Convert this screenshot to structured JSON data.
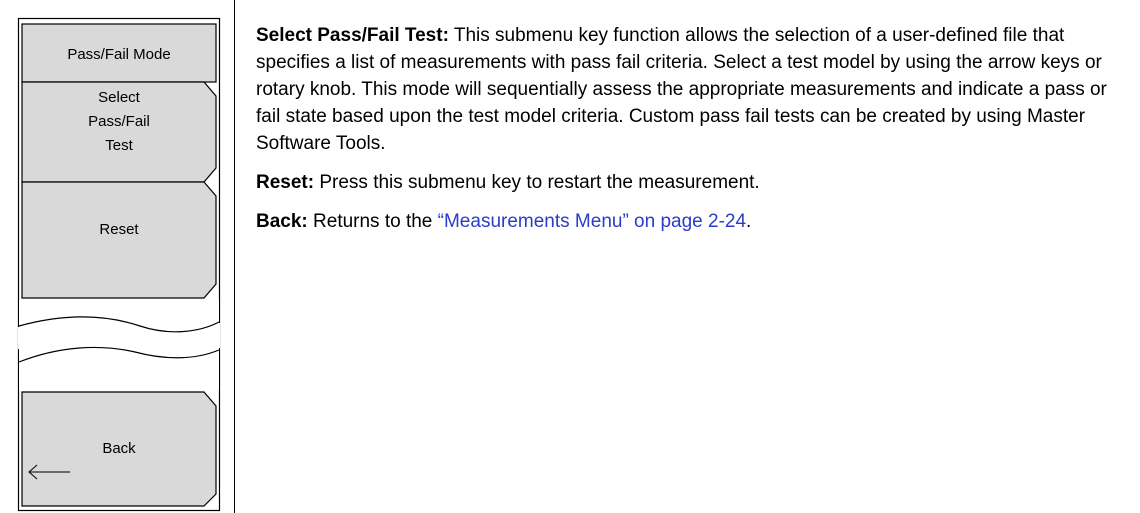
{
  "menu": {
    "title": "Pass/Fail Mode",
    "keys": [
      {
        "label": "Select\nPass/Fail\nTest"
      },
      {
        "label": "Reset"
      }
    ],
    "back": {
      "label": "Back",
      "icon": "left-arrow-icon"
    }
  },
  "descriptions": [
    {
      "term": "Select Pass/Fail Test:",
      "text": " This submenu key function allows the selection of a user-defined file that specifies a list of measurements with pass fail criteria. Select a test model by using the arrow keys or rotary knob. This mode will sequentially assess the appropriate measurements and indicate a pass or fail state based upon the test model criteria. Custom pass fail tests can be created by using Master Software Tools."
    },
    {
      "term": "Reset:",
      "text": " Press this submenu key to restart the measurement."
    },
    {
      "term": "Back:",
      "text_before": " Returns to the ",
      "link": "“Measurements Menu” on page 2-24",
      "text_after": "."
    }
  ],
  "colors": {
    "key_fill": "#d9d9d9",
    "link": "#2b3cc8"
  }
}
